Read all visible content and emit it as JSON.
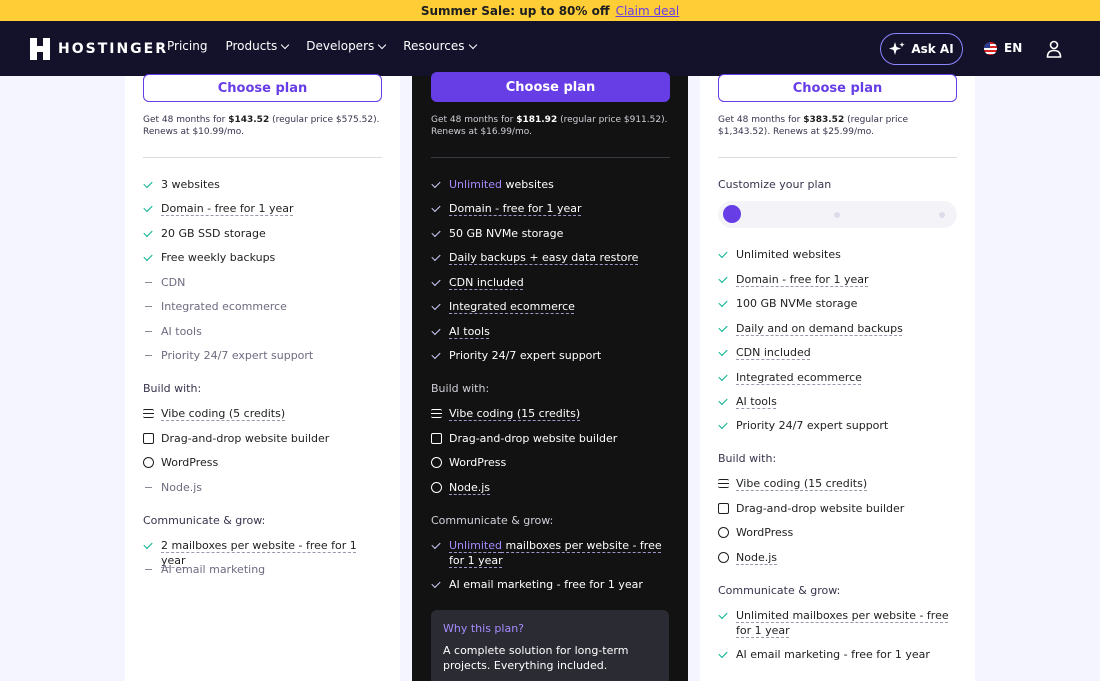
{
  "promo": {
    "text": "Summer Sale: up to 80% off",
    "cta": "Claim deal"
  },
  "nav": {
    "logo": "HOSTINGER",
    "links": [
      "Pricing",
      "Products",
      "Developers",
      "Resources"
    ],
    "ask_ai": "Ask AI",
    "language": "EN"
  },
  "plans": [
    {
      "button": "Choose plan",
      "price_prefix": "Get 48 months for ",
      "price": "$143.52",
      "price_suffix": " (regular price $575.52). Renews at $10.99/mo.",
      "features": [
        {
          "text": "3 websites",
          "on": true
        },
        {
          "text": "Domain - free for 1 year",
          "on": true
        },
        {
          "text": "20 GB SSD storage",
          "on": true
        },
        {
          "text": "Free weekly backups",
          "on": true
        },
        {
          "text": "CDN",
          "on": false
        },
        {
          "text": "Integrated ecommerce",
          "on": false
        },
        {
          "text": "AI tools",
          "on": false
        },
        {
          "text": "Priority 24/7 expert support",
          "on": false
        }
      ],
      "build_title": "Build with:",
      "build": [
        "Vibe coding (5 credits)",
        "Drag-and-drop website builder",
        "WordPress",
        "Node.js"
      ],
      "grow_title": "Communicate & grow:",
      "grow": [
        "2 mailboxes per website - free for 1 year",
        "AI email marketing"
      ]
    },
    {
      "button": "Choose plan",
      "price_prefix": "Get 48 months for ",
      "price": "$181.92",
      "price_suffix": " (regular price $911.52). Renews at $16.99/mo.",
      "features": [
        {
          "hl": "Unlimited",
          "text": " websites"
        },
        {
          "text": "Domain - free for 1 year"
        },
        {
          "text": "50 GB NVMe storage"
        },
        {
          "text": "Daily backups + easy data restore"
        },
        {
          "text": "CDN included"
        },
        {
          "text": "Integrated ecommerce"
        },
        {
          "text": "AI tools"
        },
        {
          "text": "Priority 24/7 expert support"
        }
      ],
      "build_title": "Build with:",
      "build": [
        "Vibe coding (15 credits)",
        "Drag-and-drop website builder",
        "WordPress",
        "Node.js"
      ],
      "grow_title": "Communicate & grow:",
      "grow_hl": "Unlimited",
      "grow": [
        " mailboxes per website - free for 1 year",
        "AI email marketing - free for 1 year"
      ],
      "why_q": "Why this plan?",
      "why_a": "A complete solution for long-term projects. Everything included."
    },
    {
      "button": "Choose plan",
      "price_prefix": "Get 48 months for ",
      "price": "$383.52",
      "price_suffix": " (regular price $1,343.52). Renews at $25.99/mo.",
      "customize": "Customize your plan",
      "features": [
        {
          "text": "Unlimited websites"
        },
        {
          "text": "Domain - free for 1 year"
        },
        {
          "text": "100 GB NVMe storage"
        },
        {
          "text": "Daily and on demand backups"
        },
        {
          "text": "CDN included"
        },
        {
          "text": "Integrated ecommerce"
        },
        {
          "text": "AI tools"
        },
        {
          "text": "Priority 24/7 expert support"
        }
      ],
      "build_title": "Build with:",
      "build": [
        "Vibe coding (15 credits)",
        "Drag-and-drop website builder",
        "WordPress",
        "Node.js"
      ],
      "grow_title": "Communicate & grow:",
      "grow": [
        "Unlimited mailboxes per website - free for 1 year",
        "AI email marketing - free for 1 year"
      ]
    }
  ]
}
